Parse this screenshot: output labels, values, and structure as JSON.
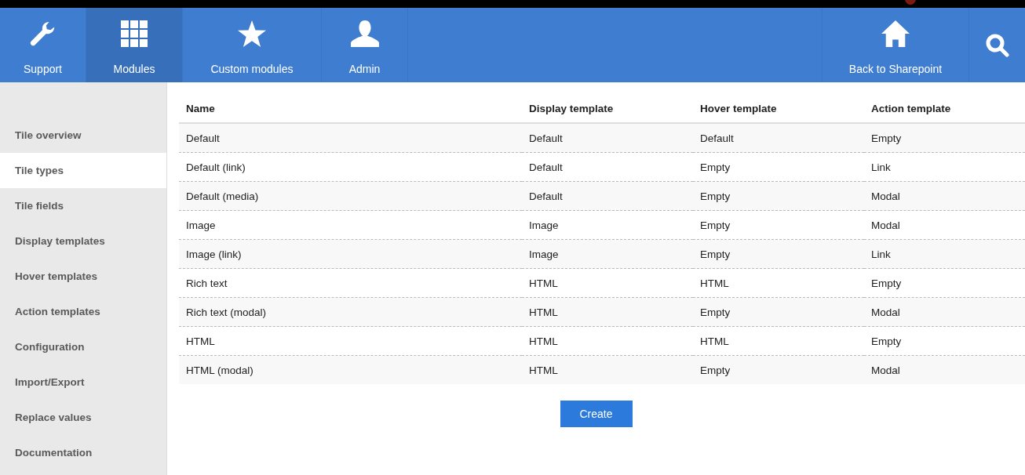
{
  "nav": {
    "items": [
      {
        "label": "Support",
        "selected": false
      },
      {
        "label": "Modules",
        "selected": true
      },
      {
        "label": "Custom modules",
        "selected": false
      },
      {
        "label": "Admin",
        "selected": false
      }
    ],
    "right_items": [
      {
        "label": "Back to Sharepoint"
      }
    ]
  },
  "sidebar": {
    "items": [
      {
        "label": "Tile overview",
        "selected": false
      },
      {
        "label": "Tile types",
        "selected": true
      },
      {
        "label": "Tile fields",
        "selected": false
      },
      {
        "label": "Display templates",
        "selected": false
      },
      {
        "label": "Hover templates",
        "selected": false
      },
      {
        "label": "Action templates",
        "selected": false
      },
      {
        "label": "Configuration",
        "selected": false
      },
      {
        "label": "Import/Export",
        "selected": false
      },
      {
        "label": "Replace values",
        "selected": false
      },
      {
        "label": "Documentation",
        "selected": false
      }
    ]
  },
  "table": {
    "columns": [
      "Name",
      "Display template",
      "Hover template",
      "Action template"
    ],
    "rows": [
      [
        "Default",
        "Default",
        "Default",
        "Empty"
      ],
      [
        "Default (link)",
        "Default",
        "Empty",
        "Link"
      ],
      [
        "Default (media)",
        "Default",
        "Empty",
        "Modal"
      ],
      [
        "Image",
        "Image",
        "Empty",
        "Modal"
      ],
      [
        "Image (link)",
        "Image",
        "Empty",
        "Link"
      ],
      [
        "Rich text",
        "HTML",
        "HTML",
        "Empty"
      ],
      [
        "Rich text (modal)",
        "HTML",
        "Empty",
        "Modal"
      ],
      [
        "HTML",
        "HTML",
        "HTML",
        "Empty"
      ],
      [
        "HTML (modal)",
        "HTML",
        "Empty",
        "Modal"
      ]
    ]
  },
  "create_button": "Create"
}
